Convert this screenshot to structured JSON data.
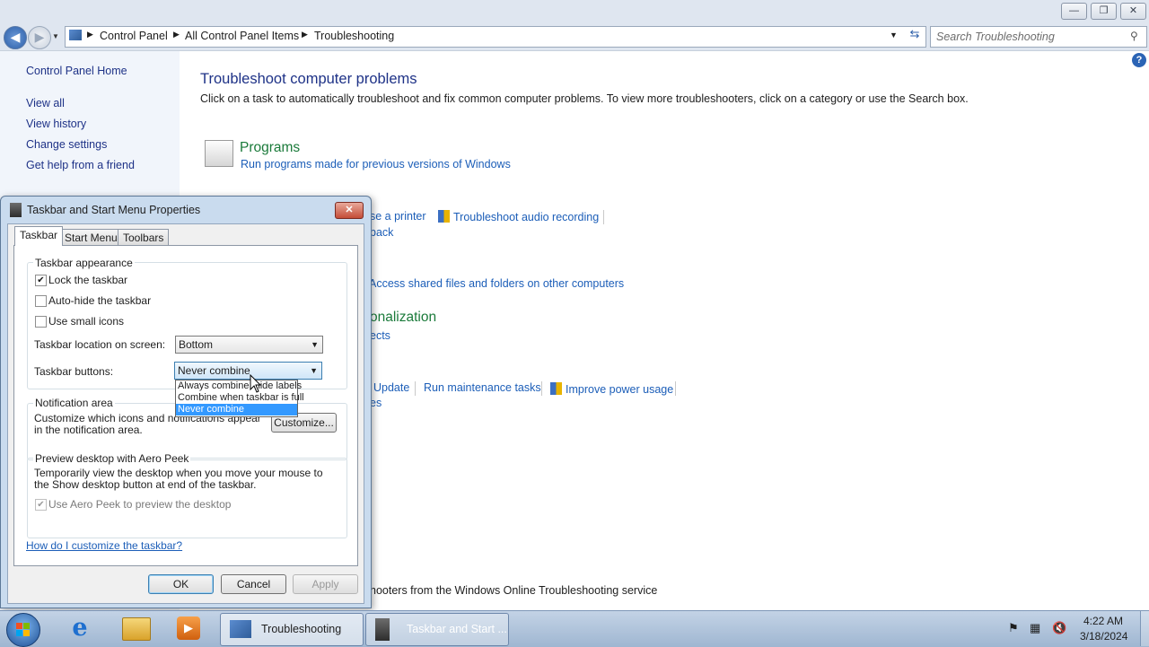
{
  "window": {
    "minimize_glyph": "—",
    "restore_glyph": "❐",
    "close_glyph": "✕"
  },
  "address": {
    "crumbs": [
      "Control Panel",
      "All Control Panel Items",
      "Troubleshooting"
    ],
    "search_placeholder": "Search Troubleshooting"
  },
  "leftnav": {
    "home": "Control Panel Home",
    "items": [
      "View all",
      "View history",
      "Change settings",
      "Get help from a friend"
    ]
  },
  "main": {
    "title": "Troubleshoot computer problems",
    "description": "Click on a task to automatically troubleshoot and fix common computer problems. To view more troubleshooters, click on a category or use the Search box.",
    "programs_title": "Programs",
    "programs_link": "Run programs made for previous versions of Windows",
    "partial_printer": "se a printer",
    "audio_recording": "Troubleshoot audio recording",
    "partial_back": "back",
    "shared_files": "Access shared files and folders on other computers",
    "partial_personalization": "onalization",
    "partial_effects": "ects",
    "partial_update": "Update",
    "maintenance": "Run maintenance tasks",
    "power": "Improve power usage",
    "partial_es": "es",
    "footer": "hooters from the Windows Online Troubleshooting service"
  },
  "dialog": {
    "title": "Taskbar and Start Menu Properties",
    "tabs": [
      "Taskbar",
      "Start Menu",
      "Toolbars"
    ],
    "appearance_label": "Taskbar appearance",
    "lock_label": "Lock the taskbar",
    "lock_checked": true,
    "autohide_label": "Auto-hide the taskbar",
    "small_icons_label": "Use small icons",
    "location_label": "Taskbar location on screen:",
    "location_value": "Bottom",
    "buttons_label": "Taskbar buttons:",
    "buttons_value": "Never combine",
    "buttons_options": [
      "Always combine, hide labels",
      "Combine when taskbar is full",
      "Never combine"
    ],
    "notification_label": "Notification area",
    "notification_text": "Customize which icons and notifications appear in the notification area.",
    "customize_button": "Customize...",
    "peek_label": "Preview desktop with Aero Peek",
    "peek_text": "Temporarily view the desktop when you move your mouse to the Show desktop button at end of the taskbar.",
    "peek_check_label": "Use Aero Peek to preview the desktop",
    "help_link": "How do I customize the taskbar?",
    "ok": "OK",
    "cancel": "Cancel",
    "apply": "Apply"
  },
  "taskbar": {
    "windows": [
      "Troubleshooting",
      "Taskbar and Start ..."
    ],
    "time": "4:22 AM",
    "date": "3/18/2024"
  },
  "colors": {
    "accent": "#3399ff",
    "link": "#1c5eb8",
    "category": "#1a7a3a"
  }
}
